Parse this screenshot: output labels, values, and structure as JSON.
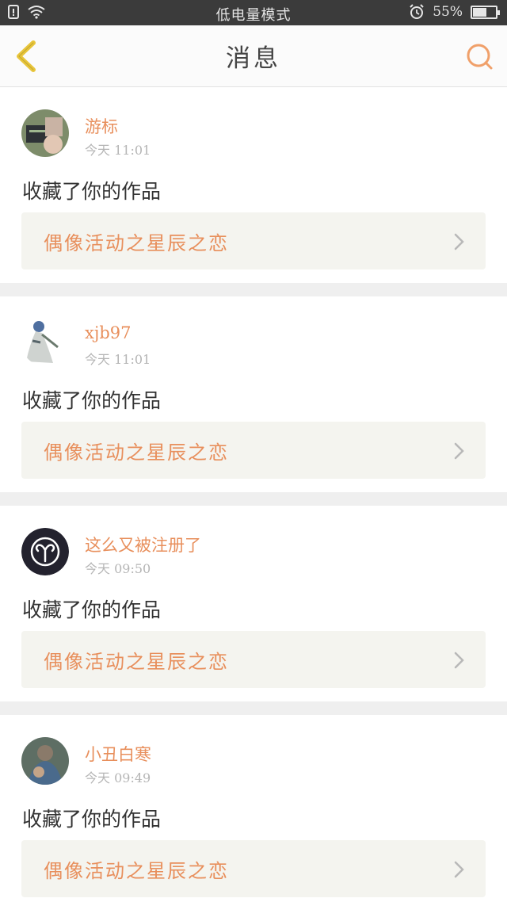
{
  "status_bar": {
    "mode_text": "低电量模式",
    "battery_percent": "55%",
    "battery_level": 0.55,
    "icons": [
      "sim-icon",
      "wifi-icon",
      "alarm-icon",
      "battery-icon"
    ]
  },
  "nav": {
    "title": "消息",
    "back_icon": "chevron-left-icon",
    "search_icon": "search-icon"
  },
  "colors": {
    "accent": "#e88f5c",
    "back_icon": "#e8c53a",
    "status_bar_bg": "#3b3b3b"
  },
  "messages": [
    {
      "username": "游标",
      "time": "今天 11:01",
      "action": "收藏了你的作品",
      "work_title": "偶像活动之星辰之恋",
      "avatar": "photo-avatar"
    },
    {
      "username": "xjb97",
      "time": "今天 11:01",
      "action": "收藏了你的作品",
      "work_title": "偶像活动之星辰之恋",
      "avatar": "figure-avatar"
    },
    {
      "username": "这么又被注册了",
      "time": "今天 09:50",
      "action": "收藏了你的作品",
      "work_title": "偶像活动之星辰之恋",
      "avatar": "aries-avatar"
    },
    {
      "username": "小丑白寒",
      "time": "今天 09:49",
      "action": "收藏了你的作品",
      "work_title": "偶像活动之星辰之恋",
      "avatar": "photo-avatar"
    }
  ]
}
